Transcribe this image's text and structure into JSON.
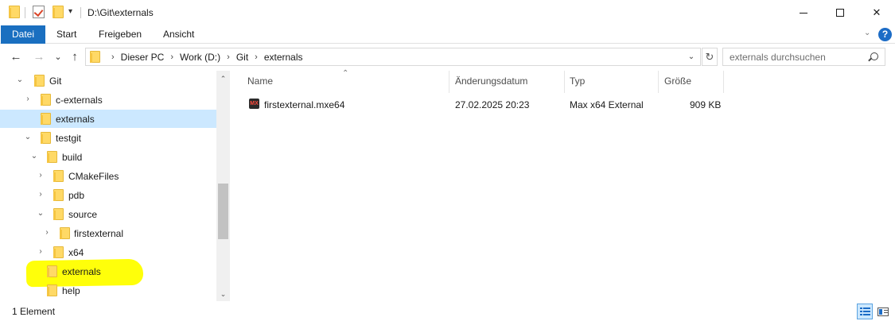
{
  "window": {
    "title": "D:\\Git\\externals",
    "minimize_label": "—",
    "close_label": "✕"
  },
  "ribbon": {
    "tabs": [
      {
        "label": "Datei"
      },
      {
        "label": "Start"
      },
      {
        "label": "Freigeben"
      },
      {
        "label": "Ansicht"
      }
    ],
    "help_label": "?"
  },
  "nav": {
    "back_glyph": "←",
    "forward_glyph": "→",
    "recent_glyph": "⌄",
    "up_glyph": "↑",
    "breadcrumbs": [
      "Dieser PC",
      "Work (D:)",
      "Git",
      "externals"
    ],
    "search_placeholder": "externals durchsuchen"
  },
  "tree": {
    "items": [
      {
        "label": "Git",
        "depth": 0,
        "expanded": true,
        "selected": false
      },
      {
        "label": "c-externals",
        "depth": 1,
        "expandable": true,
        "selected": false
      },
      {
        "label": "externals",
        "depth": 1,
        "selected": true
      },
      {
        "label": "testgit",
        "depth": 1,
        "expanded": true,
        "selected": false
      },
      {
        "label": "build",
        "depth": 2,
        "expanded": true,
        "selected": false
      },
      {
        "label": "CMakeFiles",
        "depth": 3,
        "expandable": true,
        "selected": false
      },
      {
        "label": "pdb",
        "depth": 3,
        "expandable": true,
        "selected": false
      },
      {
        "label": "source",
        "depth": 3,
        "expanded": true,
        "selected": false
      },
      {
        "label": "firstexternal",
        "depth": 4,
        "expandable": true,
        "selected": false
      },
      {
        "label": "x64",
        "depth": 3,
        "expandable": true,
        "selected": false
      },
      {
        "label": "externals",
        "depth": 2,
        "selected": false,
        "highlighted": true
      },
      {
        "label": "help",
        "depth": 2,
        "selected": false
      }
    ]
  },
  "list": {
    "columns": [
      "Name",
      "Änderungsdatum",
      "Typ",
      "Größe"
    ],
    "rows": [
      {
        "icon": "mx-icon",
        "name": "firstexternal.mxe64",
        "date": "27.02.2025 20:23",
        "type": "Max x64 External",
        "size": "909 KB"
      }
    ]
  },
  "status": {
    "count": "1 Element"
  },
  "colors": {
    "accent": "#1a6fc0",
    "selection": "#cce8ff",
    "highlight_marker": "#ffff0a",
    "folder": "#ffd966"
  }
}
